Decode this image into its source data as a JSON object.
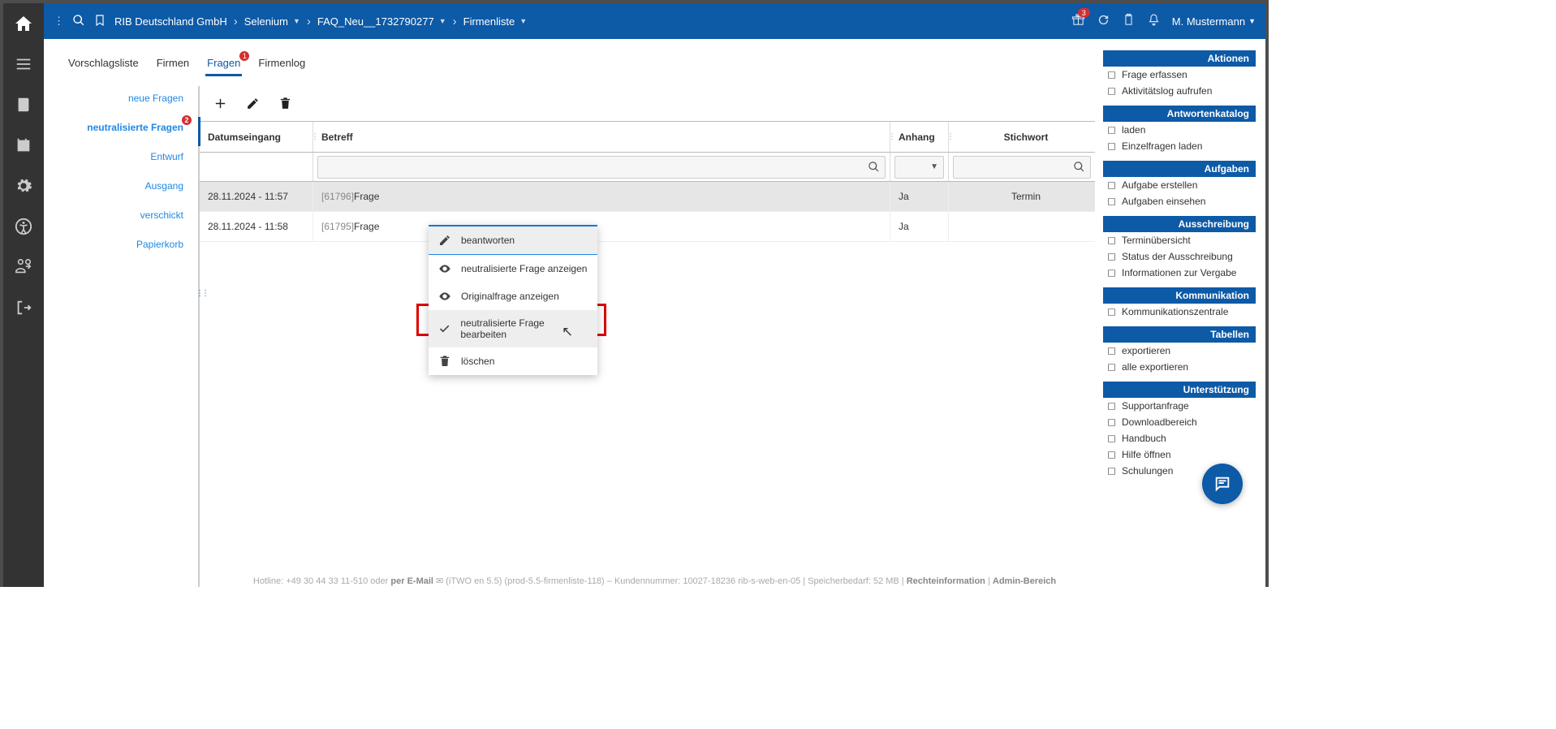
{
  "topIconBadge": "3",
  "user": "M. Mustermann",
  "breadcrumb": [
    "RIB Deutschland GmbH",
    "Selenium",
    "FAQ_Neu__1732790277",
    "Firmenliste"
  ],
  "breadcrumb_hasdropdown": [
    false,
    true,
    true,
    true
  ],
  "tabs": [
    {
      "label": "Vorschlagsliste",
      "active": false,
      "badge": null
    },
    {
      "label": "Firmen",
      "active": false,
      "badge": null
    },
    {
      "label": "Fragen",
      "active": true,
      "badge": "1"
    },
    {
      "label": "Firmenlog",
      "active": false,
      "badge": null
    }
  ],
  "subnav": [
    {
      "label": "neue Fragen",
      "badge": null,
      "active": false
    },
    {
      "label": "neutralisierte Fragen",
      "badge": "2",
      "active": true
    },
    {
      "label": "Entwurf",
      "badge": null,
      "active": false
    },
    {
      "label": "Ausgang",
      "badge": null,
      "active": false
    },
    {
      "label": "verschickt",
      "badge": null,
      "active": false
    },
    {
      "label": "Papierkorb",
      "badge": null,
      "active": false
    }
  ],
  "cols": {
    "date": "Datumseingang",
    "subject": "Betreff",
    "attachment": "Anhang",
    "keyword": "Stichwort"
  },
  "rows": [
    {
      "date": "28.11.2024 - 11:57",
      "id": "[61796]",
      "subj": "Frage",
      "att": "Ja",
      "kw": "Termin",
      "sel": true
    },
    {
      "date": "28.11.2024 - 11:58",
      "id": "[61795]",
      "subj": "Frage",
      "att": "Ja",
      "kw": "",
      "sel": false
    }
  ],
  "context": [
    {
      "label": "beantworten",
      "icon": "edit"
    },
    {
      "label": "neutralisierte Frage anzeigen",
      "icon": "eye"
    },
    {
      "label": "Originalfrage anzeigen",
      "icon": "eye"
    },
    {
      "label": "neutralisierte Frage bearbeiten",
      "icon": "check",
      "highlight": true
    },
    {
      "label": "löschen",
      "icon": "trash"
    }
  ],
  "right": [
    {
      "title": "Aktionen",
      "items": [
        "Frage erfassen",
        "Aktivitätslog aufrufen"
      ]
    },
    {
      "title": "Antwortenkatalog",
      "items": [
        "laden",
        "Einzelfragen laden"
      ]
    },
    {
      "title": "Aufgaben",
      "items": [
        "Aufgabe erstellen",
        "Aufgaben einsehen"
      ]
    },
    {
      "title": "Ausschreibung",
      "items": [
        "Terminübersicht",
        "Status der Ausschreibung",
        "Informationen zur Vergabe"
      ]
    },
    {
      "title": "Kommunikation",
      "items": [
        "Kommunikationszentrale"
      ]
    },
    {
      "title": "Tabellen",
      "items": [
        "exportieren",
        "alle exportieren"
      ]
    },
    {
      "title": "Unterstützung",
      "items": [
        "Supportanfrage",
        "Downloadbereich",
        "Handbuch",
        "Hilfe öffnen",
        "Schulungen"
      ]
    }
  ],
  "footer": {
    "hotline_pre": "Hotline: +49 30 44 33 11-510 oder ",
    "hotline_link": "per E-Mail",
    "meta": " (iTWO en 5.5) (prod-5.5-firmenliste-118) – Kundennummer: 10027-18236 rib-s-web-en-05 | Speicherbedarf: 52 MB | ",
    "link1": "Rechteinformation",
    "link2": "Admin-Bereich"
  }
}
